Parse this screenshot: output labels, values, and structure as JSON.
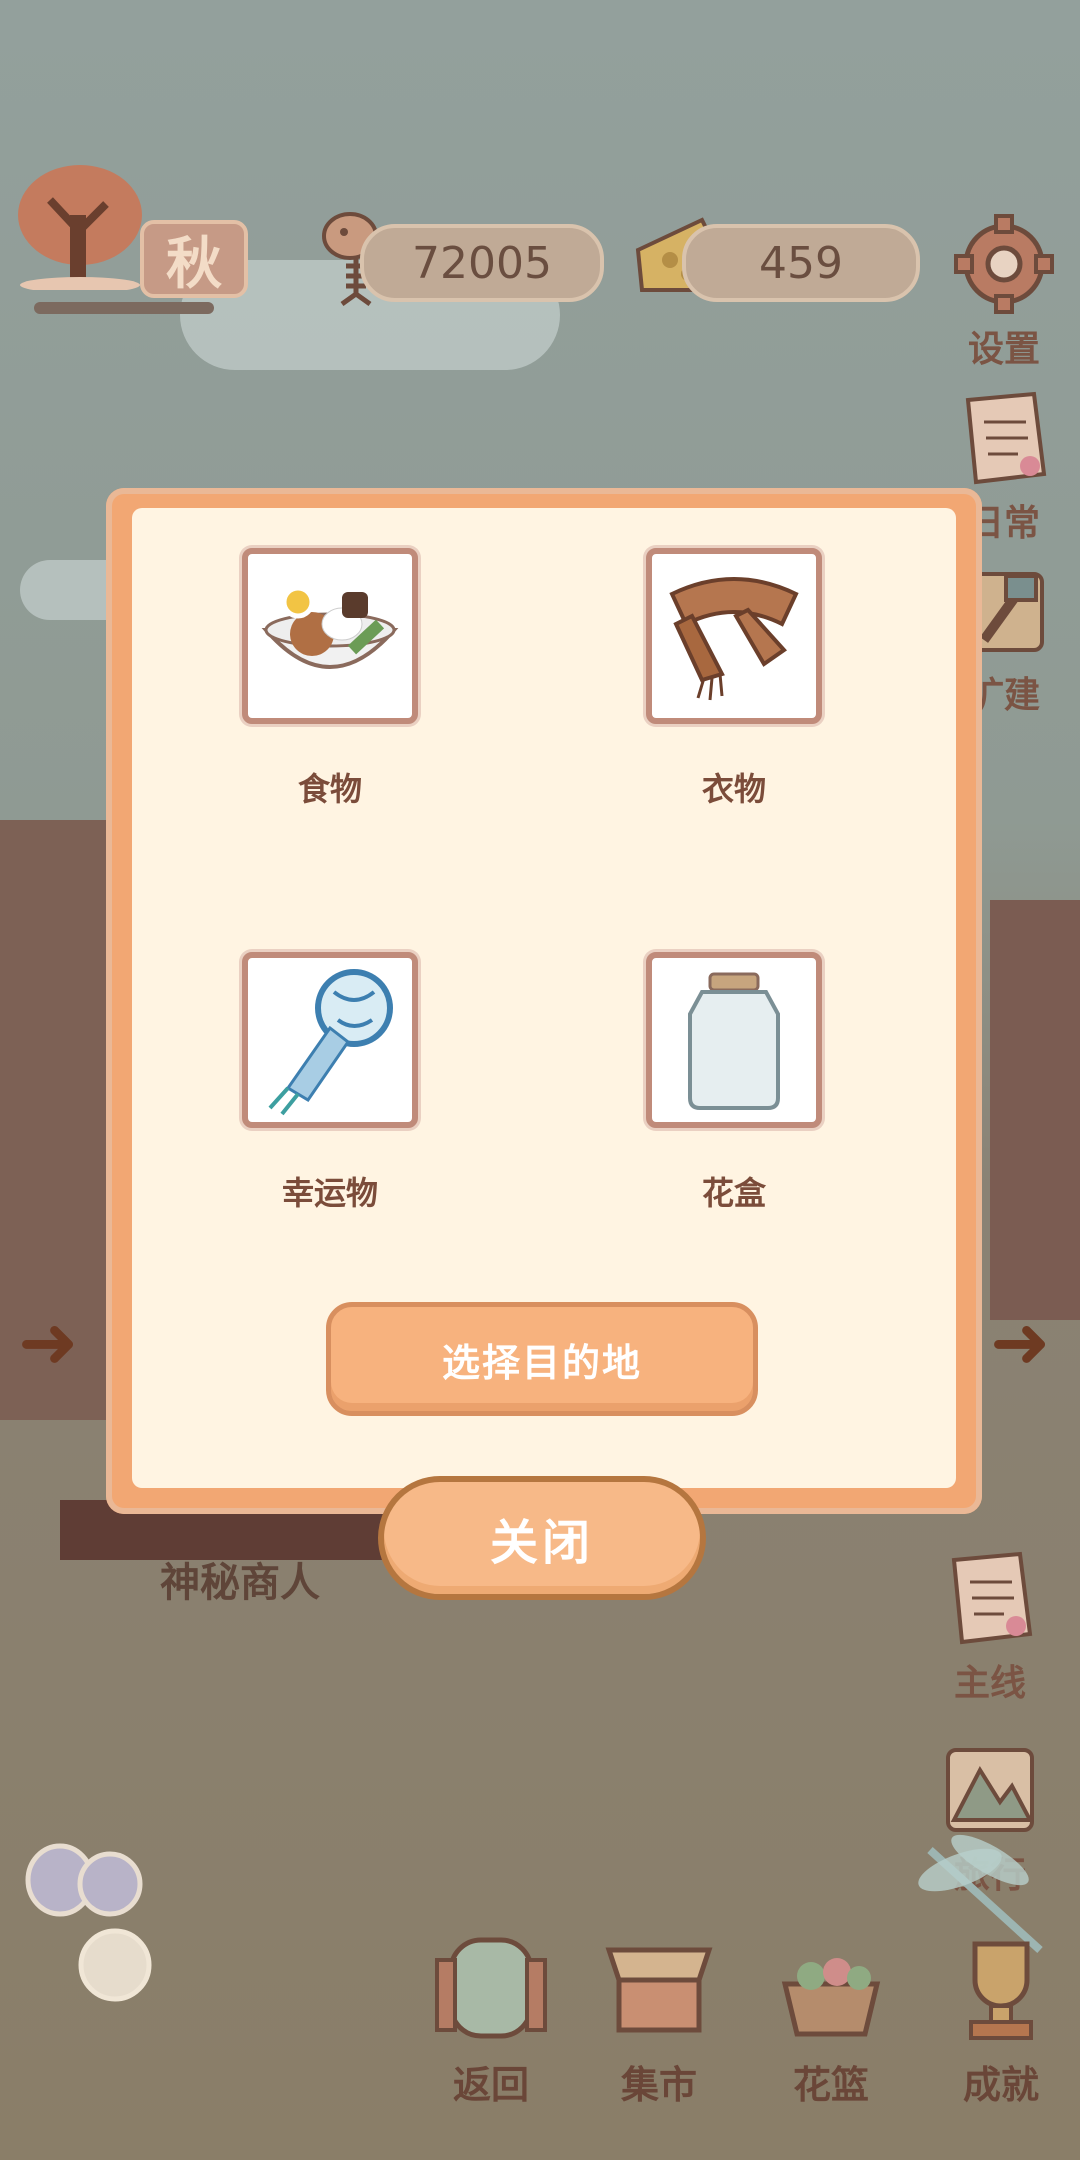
{
  "top_bar": {
    "season": "秋",
    "fish_count": "72005",
    "cheese_count": "459"
  },
  "side_right": [
    {
      "label": "设置",
      "icon": "gear-icon"
    },
    {
      "label": "日常",
      "icon": "tips-note-icon"
    },
    {
      "label": "扩建",
      "icon": "hammer-icon"
    }
  ],
  "side_right_lower": [
    {
      "label": "主线",
      "icon": "tips-note-icon"
    },
    {
      "label": "旅行",
      "icon": "mountain-icon"
    }
  ],
  "scene": {
    "stall_label": "神秘商人"
  },
  "bottom_bar": [
    {
      "label": "返回",
      "icon": "window-icon"
    },
    {
      "label": "集市",
      "icon": "market-stall-icon"
    },
    {
      "label": "花篮",
      "icon": "flower-basket-icon"
    },
    {
      "label": "成就",
      "icon": "trophy-icon"
    }
  ],
  "modal": {
    "items": [
      {
        "label": "食物",
        "icon": "rice-bowl-icon"
      },
      {
        "label": "衣物",
        "icon": "scarf-icon"
      },
      {
        "label": "幸运物",
        "icon": "windchime-icon"
      },
      {
        "label": "花盒",
        "icon": "glass-jar-icon"
      }
    ],
    "destination_button": "选择目的地",
    "close_button": "关闭"
  },
  "colors": {
    "modal_border": "#f2a773",
    "modal_bg": "#fff4e2",
    "button_fill": "#f7b27e"
  }
}
